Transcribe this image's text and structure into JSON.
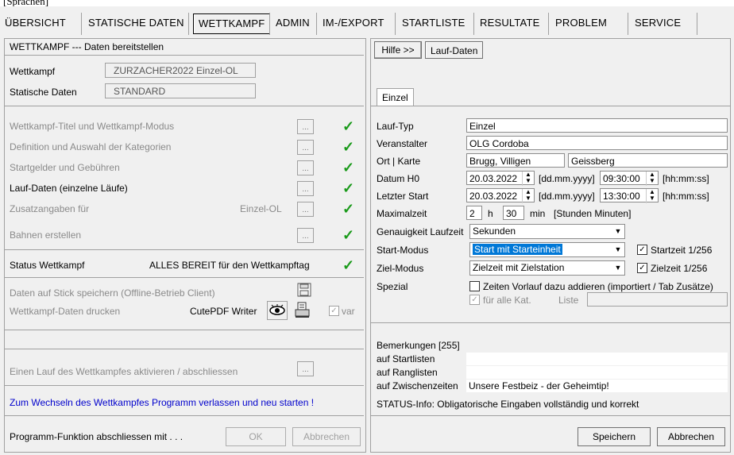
{
  "top_caption": "[Sprachen]",
  "menu": [
    "ÜBERSICHT",
    "STATISCHE DATEN",
    "WETTKAMPF",
    "ADMIN",
    "IM-/EXPORT",
    "STARTLISTE",
    "RESULTATE",
    "PROBLEM",
    "SERVICE"
  ],
  "left": {
    "title": "WETTKAMPF --- Daten bereitstellen",
    "wettkampf_label": "Wettkampf",
    "wettkampf_value": "ZURZACHER2022   Einzel-OL",
    "statische_label": "Statische Daten",
    "statische_value": "STANDARD",
    "steps": [
      "Wettkampf-Titel und Wettkampf-Modus",
      "Definition und Auswahl der Kategorien",
      "Startgelder und Gebühren",
      "Lauf-Daten (einzelne Läufe)",
      "Zusatzangaben für",
      "Bahnen erstellen"
    ],
    "zusatz_suffix": "Einzel-OL",
    "status_label": "Status Wettkampf",
    "status_value": "ALLES BEREIT für den Wettkampftag",
    "stick_label": "Daten auf Stick speichern (Offline-Betrieb Client)",
    "print_label": "Wettkampf-Daten drucken",
    "printer": "CutePDF Writer",
    "var_label": "var",
    "activate_label": "Einen Lauf des Wettkampfes aktivieren / abschliessen",
    "restart_note": "Zum Wechseln des Wettkampfes Programm verlassen und neu starten !",
    "finish_label": "Programm-Funktion abschliessen mit . . .",
    "ok": "OK",
    "cancel": "Abbrechen"
  },
  "right": {
    "help_btn": "Hilfe >>",
    "tab_top": "Lauf-Daten",
    "tab_inner": "Einzel",
    "lauf_typ_label": "Lauf-Typ",
    "lauf_typ": "Einzel",
    "veranstalter_label": "Veranstalter",
    "veranstalter": "OLG Cordoba",
    "ort_label": "Ort | Karte",
    "ort": "Brugg, Villigen",
    "karte": "Geissberg",
    "datum_label": "Datum  H0",
    "datum": "20.03.2022",
    "datum_fmt": "[dd.mm.yyyy]",
    "zeit_h0": "09:30:00",
    "zeit_fmt": "[hh:mm:ss]",
    "letzter_label": "Letzter Start",
    "letzter_datum": "20.03.2022",
    "letzter_zeit": "13:30:00",
    "max_label": "Maximalzeit",
    "max_h": "2",
    "h_unit": "h",
    "max_min": "30",
    "min_unit": "min",
    "max_fmt": "[Stunden Minuten]",
    "genau_label": "Genauigkeit Laufzeit",
    "genau": "Sekunden",
    "startmodus_label": "Start-Modus",
    "startmodus": "Start mit Starteinheit",
    "startzeit_cb": "Startzeit 1/256",
    "zielmodus_label": "Ziel-Modus",
    "zielmodus": "Zielzeit mit Zielstation",
    "zielzeit_cb": "Zielzeit 1/256",
    "spezial_label": "Spezial",
    "spezial_cb": "Zeiten Vorlauf dazu addieren (importiert / Tab Zusätze)",
    "alle_kat": "für alle Kat.",
    "liste": "Liste",
    "bem_label": "Bemerkungen [255]",
    "auf_start": "auf Startlisten",
    "auf_rang": "auf Ranglisten",
    "auf_zwischen": "auf Zwischenzeiten",
    "zwischen_value": "Unsere Festbeiz - der Geheimtip!",
    "status_info": "STATUS-Info:  Obligatorische Eingaben vollständig und korrekt",
    "save": "Speichern",
    "cancel": "Abbrechen"
  }
}
